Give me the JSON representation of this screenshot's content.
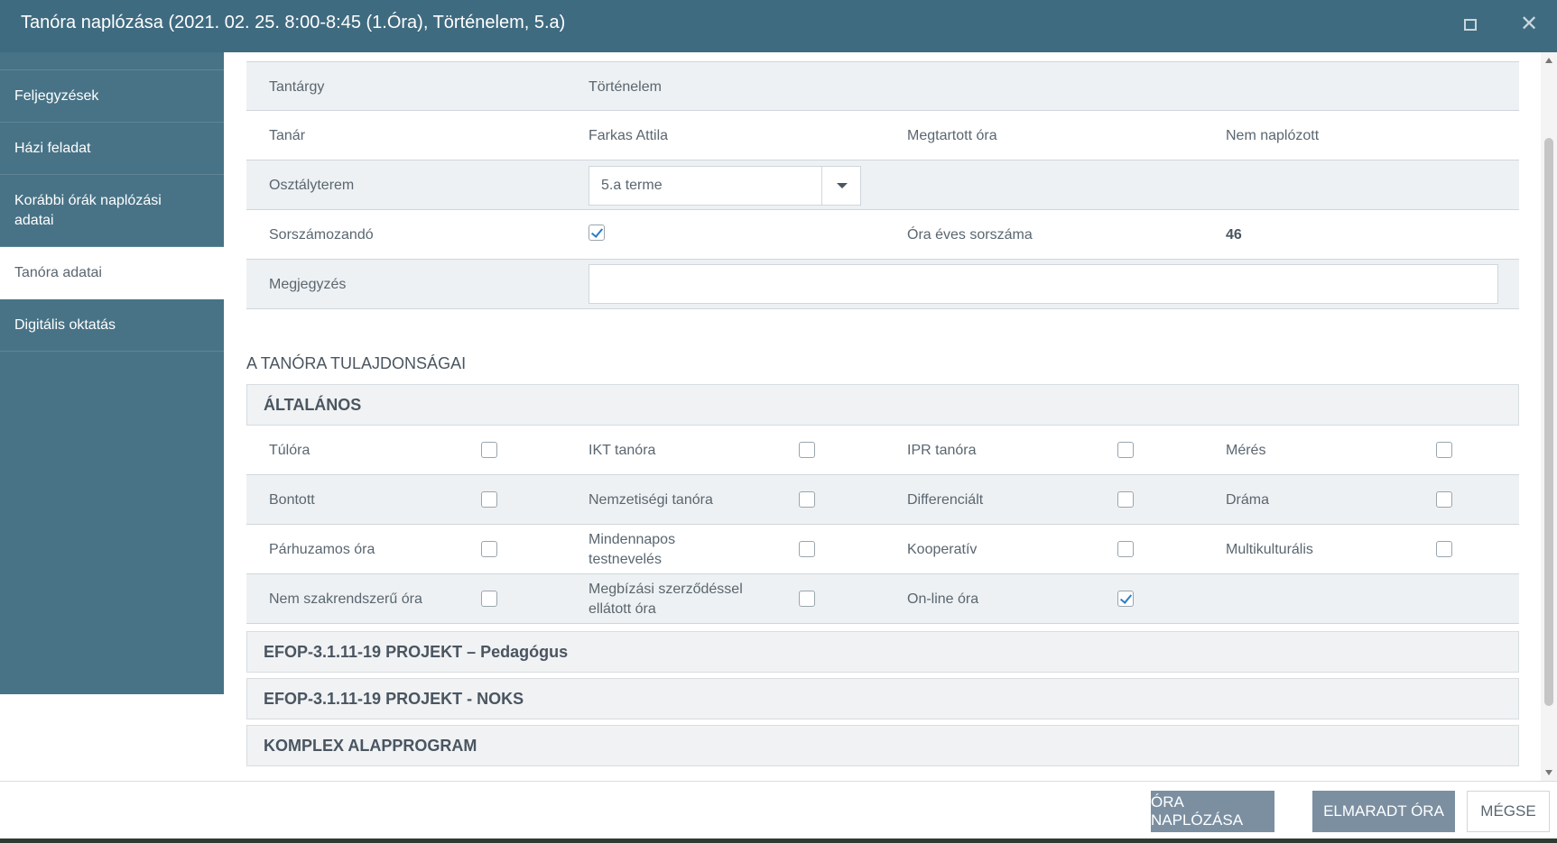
{
  "window": {
    "title": "Tanóra naplózása (2021. 02. 25. 8:00-8:45 (1.Óra), Történelem, 5.a)",
    "maximize_icon": "maximize-icon",
    "close_icon": "close-icon",
    "close_glyph": "✕"
  },
  "sidebar": {
    "items": [
      {
        "label": "Feljegyzések"
      },
      {
        "label": "Házi feladat"
      },
      {
        "label": "Korábbi órák naplózási adatai"
      },
      {
        "label": "Tanóra adatai"
      },
      {
        "label": "Digitális oktatás"
      }
    ],
    "active_index": 3
  },
  "details": {
    "subject_label": "Tantárgy",
    "subject_value": "Történelem",
    "teacher_label": "Tanár",
    "teacher_value": "Farkas Attila",
    "held_label": "Megtartott óra",
    "held_value": "Nem naplózott",
    "room_label": "Osztályterem",
    "room_value": "5.a terme",
    "numbered_label": "Sorszámozandó",
    "numbered_checked": true,
    "yearly_number_label": "Óra éves sorszáma",
    "yearly_number_value": "46",
    "note_label": "Megjegyzés",
    "note_value": ""
  },
  "properties": {
    "section_title": "A TANÓRA TULAJDONSÁGAI",
    "general_title": "ÁLTALÁNOS",
    "rows": [
      [
        {
          "label": "Túlóra",
          "checked": false
        },
        {
          "label": "IKT tanóra",
          "checked": false
        },
        {
          "label": "IPR tanóra",
          "checked": false
        },
        {
          "label": "Mérés",
          "checked": false
        }
      ],
      [
        {
          "label": "Bontott",
          "checked": false
        },
        {
          "label": "Nemzetiségi tanóra",
          "checked": false
        },
        {
          "label": "Differenciált",
          "checked": false
        },
        {
          "label": "Dráma",
          "checked": false
        }
      ],
      [
        {
          "label": "Párhuzamos óra",
          "checked": false
        },
        {
          "label": "Mindennapos testnevelés",
          "checked": false
        },
        {
          "label": "Kooperatív",
          "checked": false
        },
        {
          "label": "Multikulturális",
          "checked": false
        }
      ],
      [
        {
          "label": "Nem szakrendszerű óra",
          "checked": false
        },
        {
          "label": "Megbízási szerződéssel ellátott óra",
          "checked": false
        },
        {
          "label": "On-line óra",
          "checked": true
        }
      ]
    ],
    "groups": [
      "EFOP-3.1.11-19 PROJEKT – Pedagógus",
      "EFOP-3.1.11-19 PROJEKT - NOKS",
      "KOMPLEX ALAPPROGRAM"
    ]
  },
  "footer": {
    "log_button": "ÓRA NAPLÓZÁSA",
    "missed_button": "ELMARADT ÓRA",
    "cancel_button": "MÉGSE"
  },
  "colors": {
    "titlebar": "#3f6b80",
    "sidebar": "#487386",
    "primary_button": "#7b8fa1",
    "check": "#2b7cc4"
  }
}
